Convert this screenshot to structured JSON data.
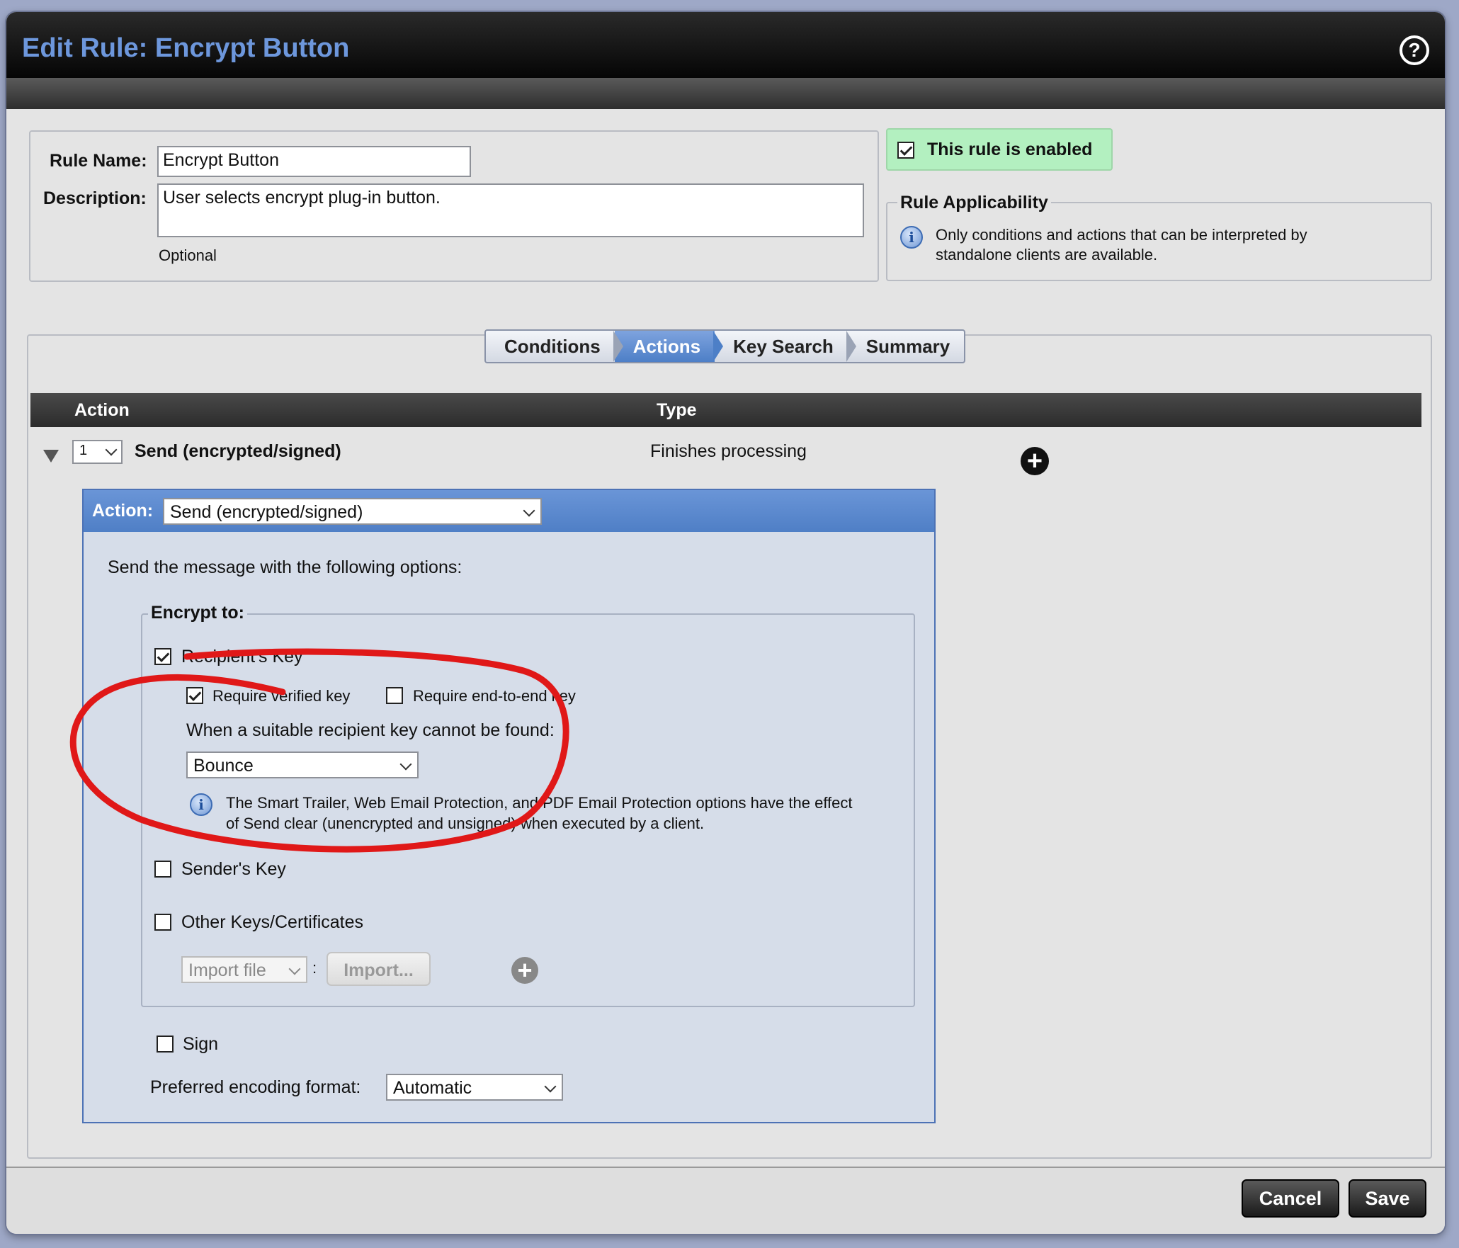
{
  "window": {
    "title": "Edit Rule: Encrypt Button",
    "help_icon": "?"
  },
  "rule": {
    "name_label": "Rule Name:",
    "name_value": "Encrypt Button",
    "description_label": "Description:",
    "description_value": "User selects encrypt plug-in button.",
    "description_hint": "Optional",
    "enabled_label": "This rule is enabled",
    "enabled": true
  },
  "applicability": {
    "legend": "Rule Applicability",
    "text_line1": "Only conditions and actions that can be interpreted by",
    "text_line2": "standalone clients are available."
  },
  "tabs": [
    {
      "label": "Conditions",
      "active": false
    },
    {
      "label": "Actions",
      "active": true
    },
    {
      "label": "Key Search",
      "active": false
    },
    {
      "label": "Summary",
      "active": false
    }
  ],
  "grid": {
    "col_action": "Action",
    "col_type": "Type",
    "row": {
      "order": "1",
      "name": "Send (encrypted/signed)",
      "type": "Finishes processing"
    }
  },
  "action_panel": {
    "action_label": "Action:",
    "action_value": "Send (encrypted/signed)",
    "intro": "Send the message with the following options:",
    "encrypt_to_legend": "Encrypt to:",
    "recipients_key": "Recipient's Key",
    "require_verified": "Require verified key",
    "require_e2e": "Require end-to-end key",
    "not_found_label": "When a suitable recipient key cannot be found:",
    "not_found_value": "Bounce",
    "note_line1": "The Smart Trailer, Web Email Protection, and PDF Email Protection options have the effect",
    "note_line2": "of Send clear (unencrypted and unsigned) when executed by a client.",
    "senders_key": "Sender's Key",
    "other_keys": "Other Keys/Certificates",
    "import_select": "Import file",
    "import_button": "Import...",
    "sign": "Sign",
    "encoding_label": "Preferred encoding format:",
    "encoding_value": "Automatic"
  },
  "footer": {
    "cancel": "Cancel",
    "save": "Save"
  },
  "colors": {
    "title_text": "#6d97dc",
    "enabled_bg": "#b3f0c0",
    "active_tab": "#4d7fc7",
    "annotation": "#e01818"
  }
}
